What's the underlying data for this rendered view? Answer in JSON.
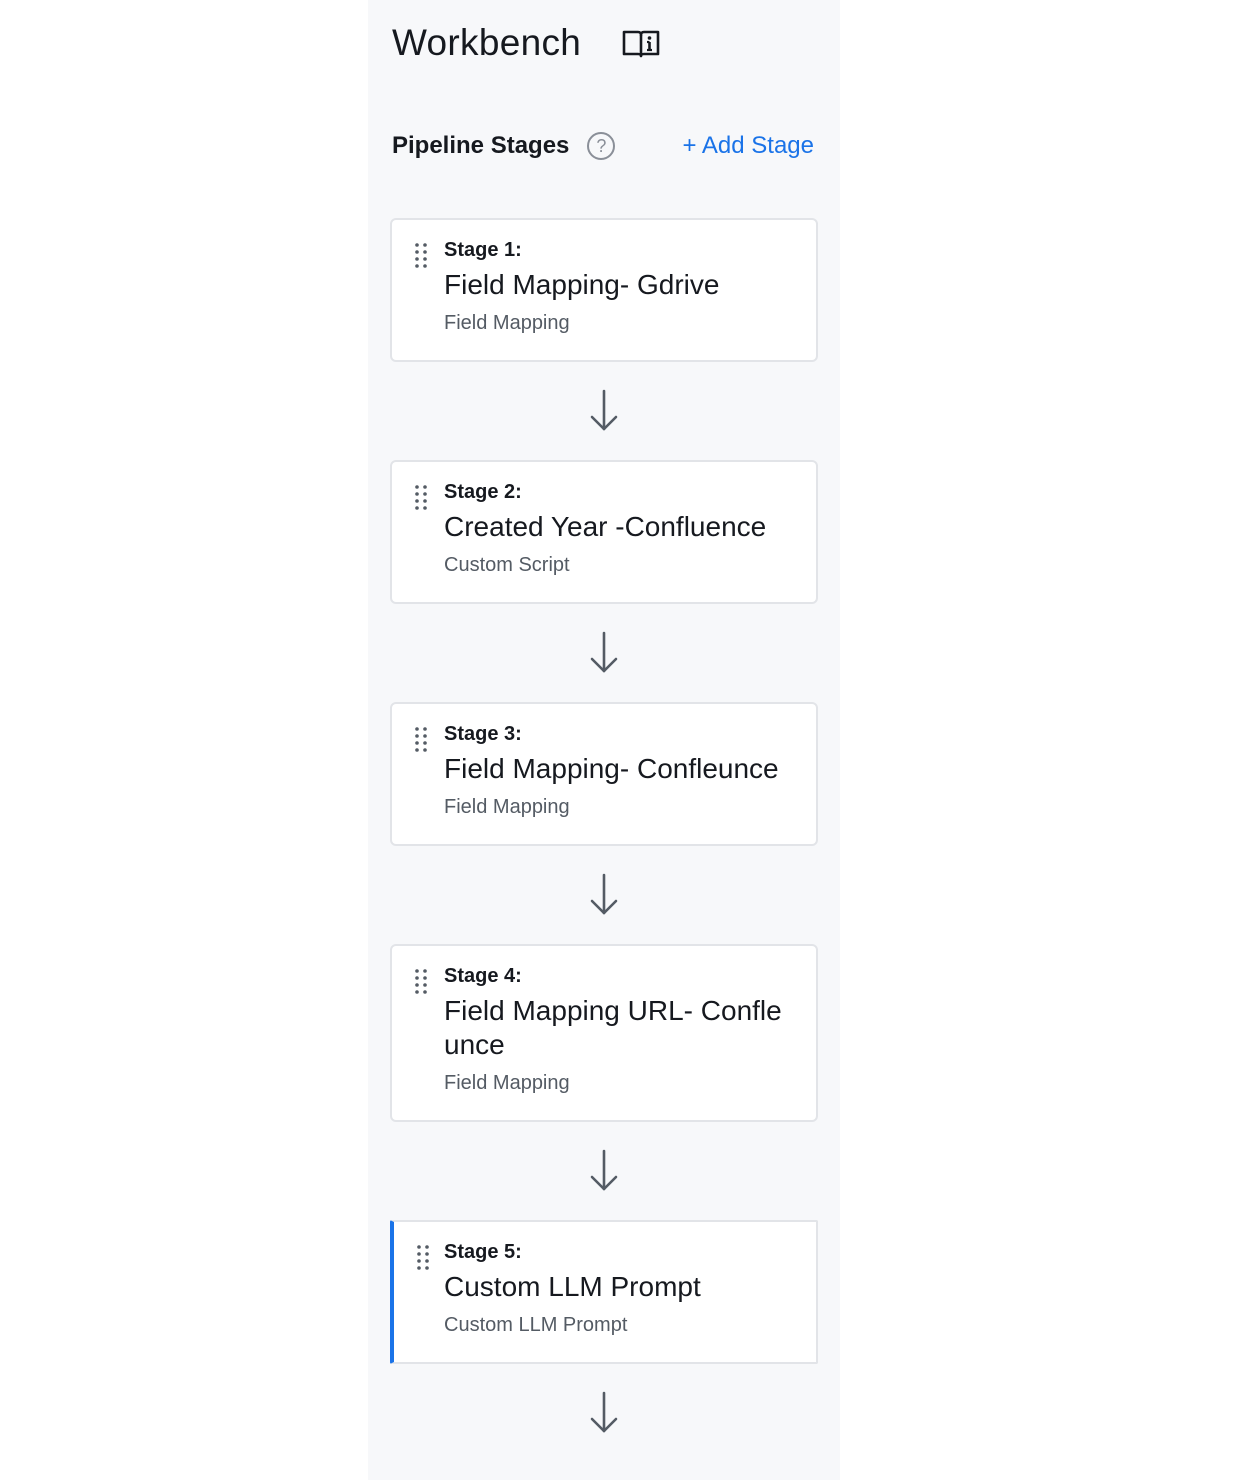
{
  "header": {
    "title": "Workbench",
    "icon": "book-info-icon"
  },
  "pipeline": {
    "section_title": "Pipeline Stages",
    "help_icon_label": "?",
    "add_stage_label": "+ Add Stage",
    "stages": [
      {
        "number_label": "Stage 1:",
        "name": "Field Mapping- Gdrive",
        "type": "Field Mapping",
        "active": false
      },
      {
        "number_label": "Stage 2:",
        "name": "Created Year -Confluence",
        "type": "Custom Script",
        "active": false
      },
      {
        "number_label": "Stage 3:",
        "name": "Field Mapping- Confleunce",
        "type": "Field Mapping",
        "active": false
      },
      {
        "number_label": "Stage 4:",
        "name": "Field Mapping URL- Confleunce",
        "type": "Field Mapping",
        "active": false
      },
      {
        "number_label": "Stage 5:",
        "name": "Custom LLM Prompt",
        "type": "Custom LLM Prompt",
        "active": true
      }
    ]
  },
  "colors": {
    "accent": "#1a73e8",
    "panel_bg": "#f7f8fa",
    "text": "#16191f",
    "muted": "#545b64"
  }
}
